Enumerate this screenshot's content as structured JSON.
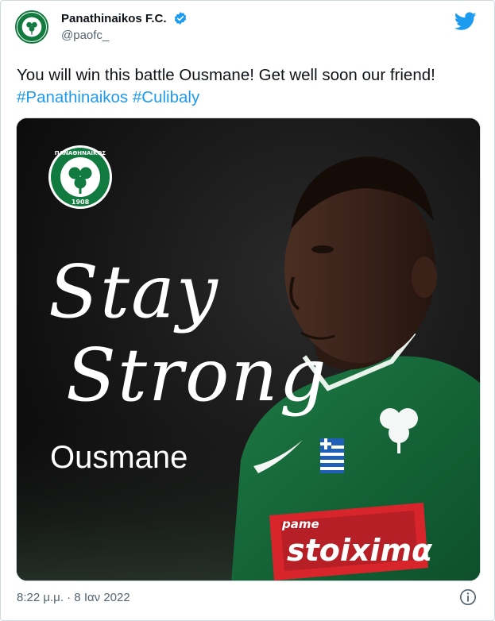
{
  "author": {
    "display_name": "Panathinaikos F.C.",
    "handle": "@paofc_",
    "verified": true
  },
  "tweet": {
    "text_main": "You will win this battle Ousmane! Get well soon our friend!",
    "hashtags": [
      "#Panathinaikos",
      "#Culibaly"
    ],
    "timestamp": "8:22 μ.μ. · 8 Ιαν 2022"
  },
  "media": {
    "headline_line1": "Stay",
    "headline_line2": "Strong",
    "player_name": "Ousmane",
    "crest_top_text": "ΠΑΝΑΘΗΝΑΪΚΟΣ",
    "crest_year": "1908",
    "sponsor_top": "pame",
    "sponsor_main": "stoiximα"
  },
  "colors": {
    "brand_green": "#117a3e",
    "link_blue": "#1d9bf0",
    "verified_blue": "#1d9bf0",
    "muted_text": "#536471"
  },
  "icons": {
    "avatar": "panathinaikos-crest-icon",
    "verified": "verified-badge-icon",
    "logo": "twitter-bird-icon",
    "info": "info-icon"
  }
}
